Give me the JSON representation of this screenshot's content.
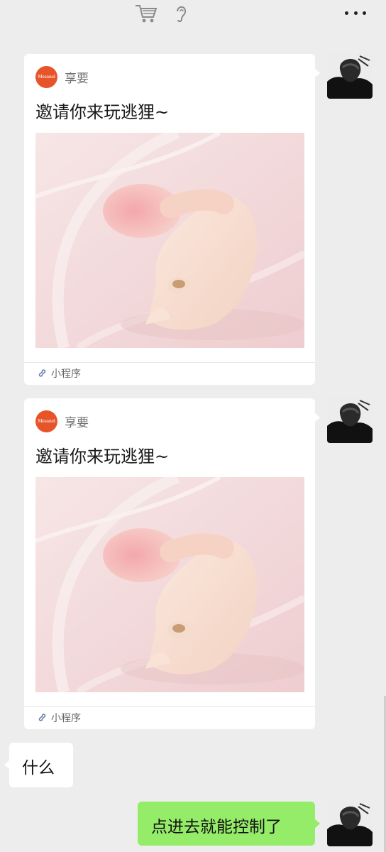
{
  "topbar": {
    "icons": [
      "shopping-cart-icon",
      "ear-icon",
      "more-icon"
    ]
  },
  "messages": [
    {
      "type": "mini-program-card",
      "brand_logo_text": "Mesanel",
      "brand_name": "享要",
      "title": "邀请你来玩逃狸~",
      "footer_label": "小程序",
      "image": "pink-product-photo"
    },
    {
      "type": "mini-program-card",
      "brand_logo_text": "Mesanel",
      "brand_name": "享要",
      "title": "邀请你来玩逃狸~",
      "footer_label": "小程序",
      "image": "pink-product-photo"
    },
    {
      "type": "text-received",
      "text": "什么"
    },
    {
      "type": "text-sent",
      "text": "点进去就能控制了"
    }
  ],
  "colors": {
    "background": "#ededed",
    "sent_bubble": "#95ec69",
    "brand_logo": "#e8542a"
  }
}
